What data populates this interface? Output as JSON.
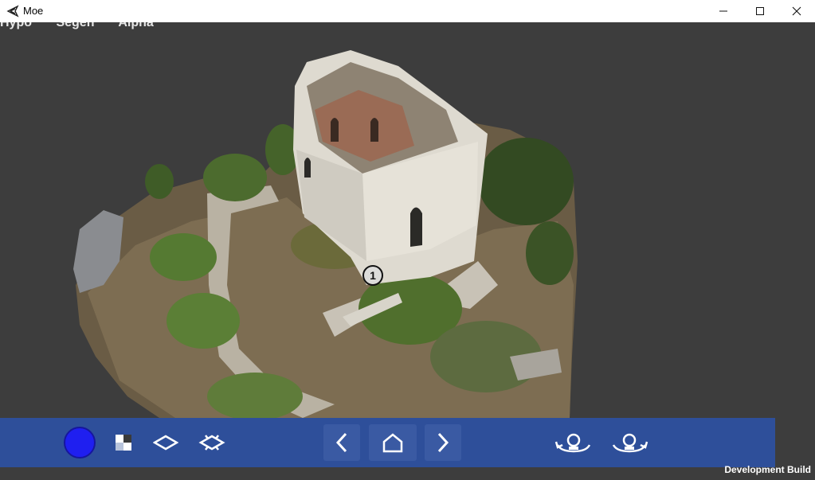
{
  "window": {
    "title": "Moe",
    "app_icon": "unity-icon"
  },
  "window_controls": [
    "minimize-icon",
    "maximize-icon",
    "close-icon"
  ],
  "menu": {
    "items": [
      "Hypo",
      "Segen",
      "Alpha"
    ]
  },
  "scene": {
    "annotation_marker": "1"
  },
  "toolbar": {
    "color_swatch": "#1f1ff0",
    "tools": [
      "checker-icon",
      "diamond-icon",
      "spiky-diamond-icon"
    ],
    "nav": [
      "chevron-left-icon",
      "home-icon",
      "chevron-right-icon"
    ],
    "rotate": [
      "rotate-left-icon",
      "rotate-right-icon"
    ]
  },
  "status": {
    "build_label": "Development Build"
  },
  "colors": {
    "toolbar_bg": "#2e4f9a",
    "viewport_bg": "#3d3d3d"
  }
}
